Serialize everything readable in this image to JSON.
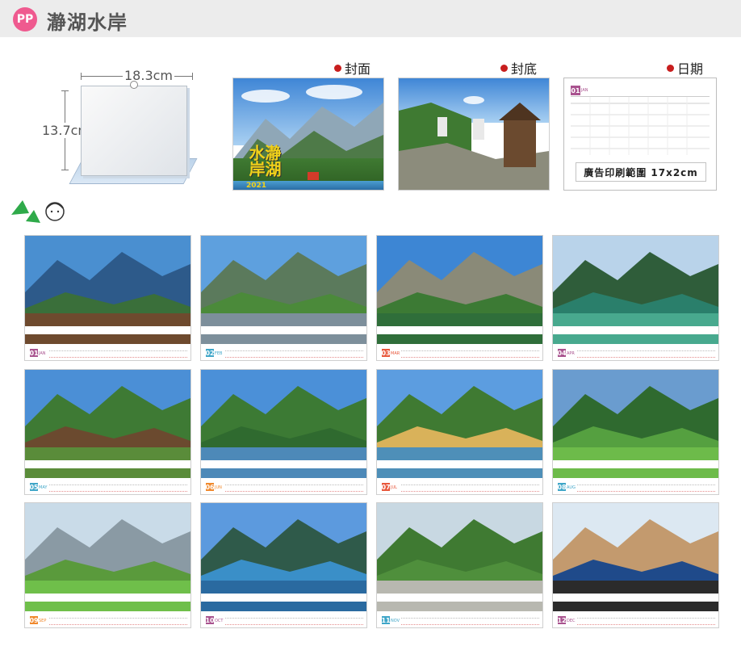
{
  "header": {
    "badge": "PP",
    "title": "瀞湖水岸"
  },
  "stand": {
    "width_label": "18.3cm",
    "height_label": "13.7cm"
  },
  "sections": {
    "cover": "封面",
    "back": "封底",
    "date": "日期"
  },
  "cover": {
    "title": "瀞湖水岸",
    "year": "2021"
  },
  "date_page": {
    "month_num": "01",
    "month_name": "JAN",
    "ad_text": "廣告印刷範圍 17x2cm"
  },
  "months": [
    {
      "num": "01",
      "name": "JAN",
      "color": "#a9538f"
    },
    {
      "num": "02",
      "name": "FEB",
      "color": "#3fa6c8"
    },
    {
      "num": "03",
      "name": "MAR",
      "color": "#e8573b"
    },
    {
      "num": "04",
      "name": "APR",
      "color": "#a9538f"
    },
    {
      "num": "05",
      "name": "MAY",
      "color": "#3fa6c8"
    },
    {
      "num": "06",
      "name": "JUN",
      "color": "#f0892d"
    },
    {
      "num": "07",
      "name": "JUL",
      "color": "#e8573b"
    },
    {
      "num": "08",
      "name": "AUG",
      "color": "#3fa6c8"
    },
    {
      "num": "09",
      "name": "SEP",
      "color": "#f0892d"
    },
    {
      "num": "10",
      "name": "OCT",
      "color": "#a9538f"
    },
    {
      "num": "11",
      "name": "NOV",
      "color": "#3fa6c8"
    },
    {
      "num": "12",
      "name": "DEC",
      "color": "#a9538f"
    }
  ]
}
